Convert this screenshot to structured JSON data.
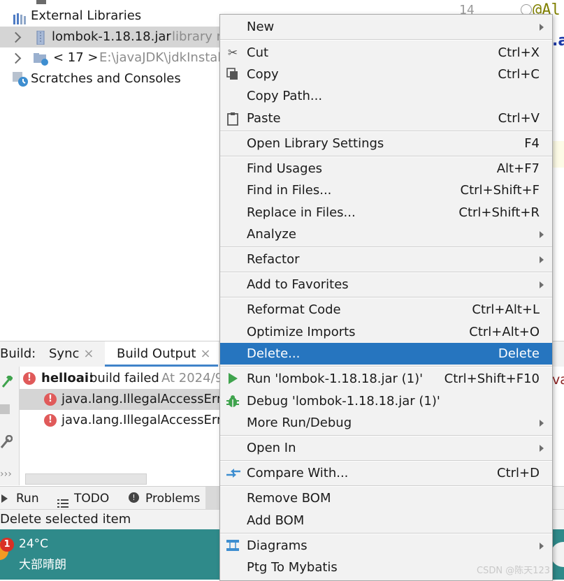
{
  "tree": {
    "external_libraries": "External Libraries",
    "lombok_jar": "lombok-1.18.18.jar",
    "lombok_suffix": "library r",
    "jdk_label": "< 17 >",
    "jdk_path": "E:\\javaJDK\\jdkInstall",
    "scratches": "Scratches and Consoles"
  },
  "editor": {
    "line_number": "14",
    "annotation": "@Al",
    "code_fragment": ".a"
  },
  "build": {
    "tab_build": "Build:",
    "tab_sync": "Sync",
    "tab_output": "Build Output",
    "close": "×",
    "rows": [
      {
        "project": "helloai:",
        "text": "build failed",
        "time": "At 2024/9"
      },
      {
        "text": "java.lang.IllegalAccessErro"
      },
      {
        "text": "java.lang.IllegalAccessErro"
      }
    ],
    "right_fragment": "va"
  },
  "tool_tabs": {
    "run": "Run",
    "todo": "TODO",
    "problems": "Problems"
  },
  "status": {
    "text": "Delete selected item"
  },
  "taskbar": {
    "badge": "1",
    "temperature": "24°C",
    "weather": "大部晴朗"
  },
  "menu": {
    "items": [
      {
        "label": "New",
        "submenu": true
      },
      {
        "label": "Cut",
        "shortcut": "Ctrl+X",
        "icon": "scissors-icon"
      },
      {
        "label": "Copy",
        "shortcut": "Ctrl+C",
        "icon": "copy-icon"
      },
      {
        "label": "Copy Path..."
      },
      {
        "label": "Paste",
        "shortcut": "Ctrl+V",
        "icon": "paste-icon"
      },
      {
        "label": "Open Library Settings",
        "shortcut": "F4"
      },
      {
        "label": "Find Usages",
        "shortcut": "Alt+F7"
      },
      {
        "label": "Find in Files...",
        "shortcut": "Ctrl+Shift+F"
      },
      {
        "label": "Replace in Files...",
        "shortcut": "Ctrl+Shift+R"
      },
      {
        "label": "Analyze",
        "submenu": true
      },
      {
        "label": "Refactor",
        "submenu": true
      },
      {
        "label": "Add to Favorites",
        "submenu": true
      },
      {
        "label": "Reformat Code",
        "shortcut": "Ctrl+Alt+L"
      },
      {
        "label": "Optimize Imports",
        "shortcut": "Ctrl+Alt+O"
      },
      {
        "label": "Delete...",
        "shortcut": "Delete",
        "selected": true
      },
      {
        "label": "Run 'lombok-1.18.18.jar (1)'",
        "shortcut": "Ctrl+Shift+F10",
        "icon": "run-icon"
      },
      {
        "label": "Debug 'lombok-1.18.18.jar (1)'",
        "icon": "debug-icon"
      },
      {
        "label": "More Run/Debug",
        "submenu": true
      },
      {
        "label": "Open In",
        "submenu": true
      },
      {
        "label": "Compare With...",
        "shortcut": "Ctrl+D",
        "icon": "compare-icon"
      },
      {
        "label": "Remove BOM"
      },
      {
        "label": "Add BOM"
      },
      {
        "label": "Diagrams",
        "submenu": true,
        "icon": "diagram-icon"
      },
      {
        "label": "Ptg To Mybatis"
      }
    ]
  },
  "watermark": "CSDN @陈天123",
  "colors": {
    "selection": "#2675bf",
    "error": "#e05a5a",
    "run": "#3fa34d",
    "taskbar": "#2f8a8a"
  }
}
